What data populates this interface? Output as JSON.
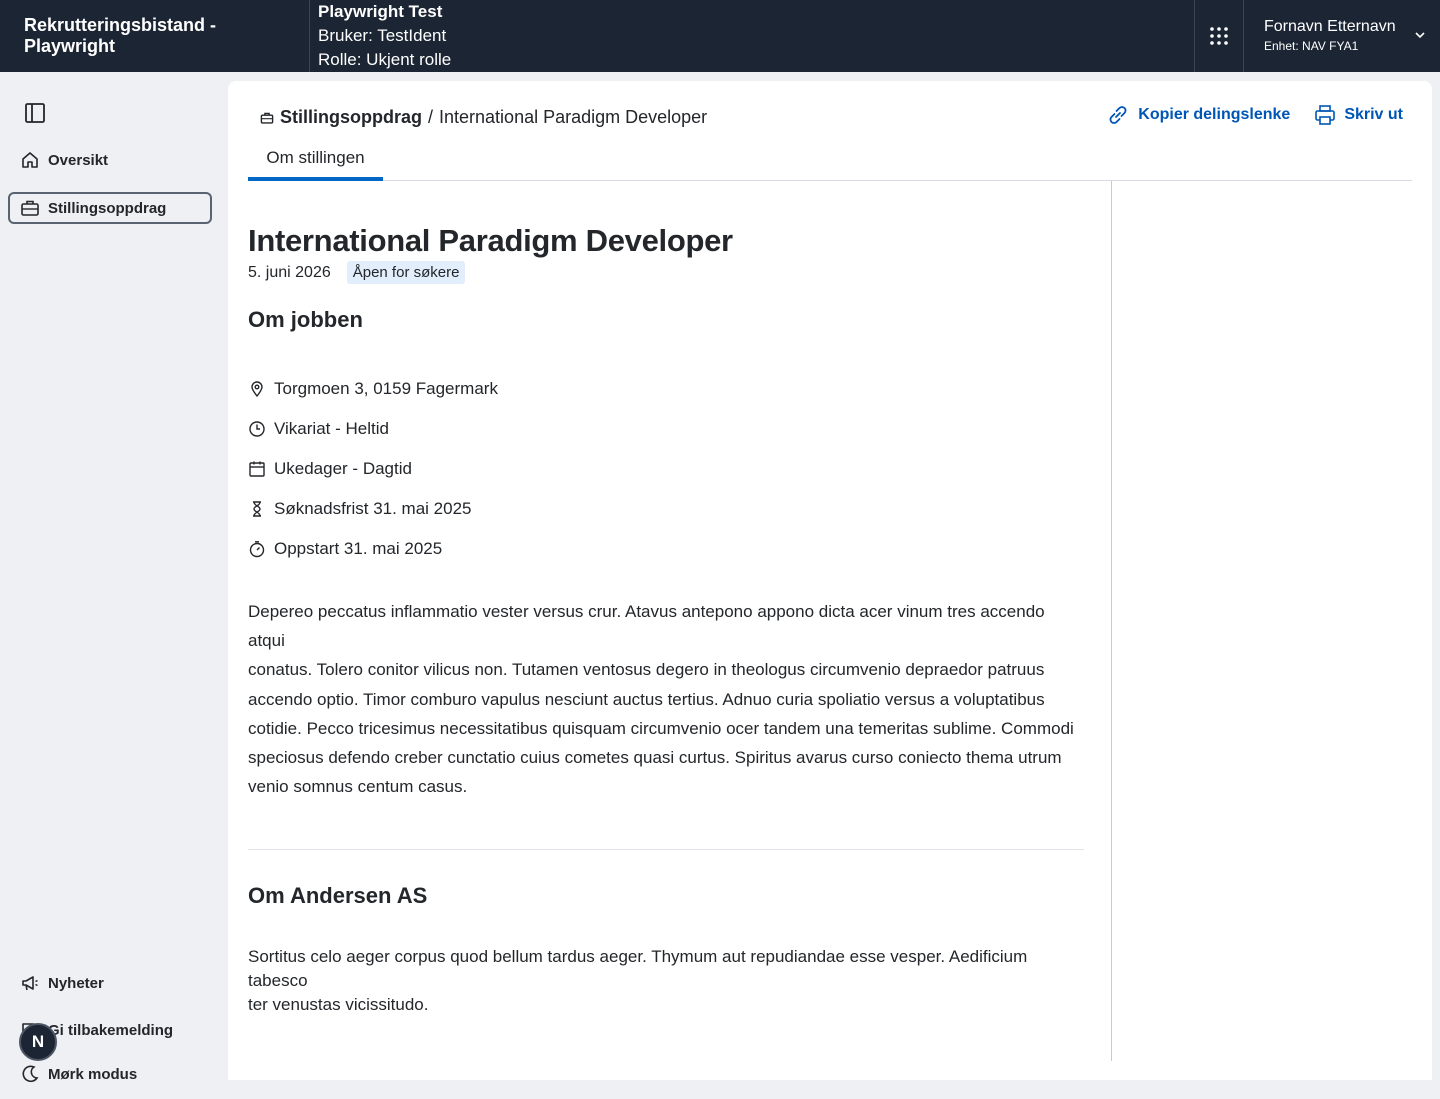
{
  "header": {
    "app_title": "Rekrutteringsbistand - Playwright",
    "env_name": "Playwright Test",
    "env_user": "Bruker: TestIdent",
    "env_role": "Rolle: Ukjent rolle",
    "user_name": "Fornavn Etternavn",
    "user_unit": "Enhet: NAV FYA1"
  },
  "sidebar": {
    "items": [
      {
        "label": "Oversikt",
        "icon": "house-icon"
      },
      {
        "label": "Stillingsoppdrag",
        "icon": "briefcase-icon",
        "active": true
      }
    ],
    "bottom_items": [
      {
        "label": "Nyheter",
        "icon": "megaphone-icon"
      },
      {
        "label": "Gi tilbakemelding",
        "icon": "chat-icon"
      },
      {
        "label": "Mørk modus",
        "icon": "moon-icon"
      }
    ],
    "avatar_letter": "N"
  },
  "breadcrumb": {
    "parent": "Stillingsoppdrag",
    "separator": "/",
    "current": "International Paradigm Developer"
  },
  "actions": {
    "share": "Kopier delingslenke",
    "print": "Skriv ut"
  },
  "tabs": [
    {
      "label": "Om stillingen",
      "active": true
    }
  ],
  "job": {
    "title": "International Paradigm Developer",
    "date": "5. juni 2026",
    "status": "Åpen for søkere",
    "about_heading": "Om jobben",
    "facts": [
      {
        "icon": "location-pin-icon",
        "text": "Torgmoen 3, 0159 Fagermark"
      },
      {
        "icon": "clock-icon",
        "text": "Vikariat - Heltid"
      },
      {
        "icon": "calendar-icon",
        "text": "Ukedager - Dagtid"
      },
      {
        "icon": "hourglass-icon",
        "text": "Søknadsfrist 31. mai 2025"
      },
      {
        "icon": "stopwatch-icon",
        "text": "Oppstart 31. mai 2025"
      }
    ],
    "description_lines": [
      "Depereo peccatus inflammatio vester versus crur. Atavus antepono appono dicta acer vinum tres accendo atqui",
      "conatus. Tolero conitor vilicus non. Tutamen ventosus degero in theologus circumvenio depraedor patruus",
      "accendo optio. Timor comburo vapulus nesciunt auctus tertius. Adnuo curia spoliatio versus a voluptatibus",
      "cotidie. Pecco tricesimus necessitatibus quisquam circumvenio ocer tandem una temeritas sublime. Commodi",
      "speciosus defendo creber cunctatio cuius cometes quasi curtus. Spiritus avarus curso coniecto thema utrum",
      "venio somnus centum casus."
    ],
    "employer_heading": "Om Andersen AS",
    "employer_description_lines": [
      "Sortitus celo aeger corpus quod bellum tardus aeger. Thymum aut repudiandae esse vesper. Aedificium tabesco",
      "ter venustas vicissitudo."
    ]
  }
}
